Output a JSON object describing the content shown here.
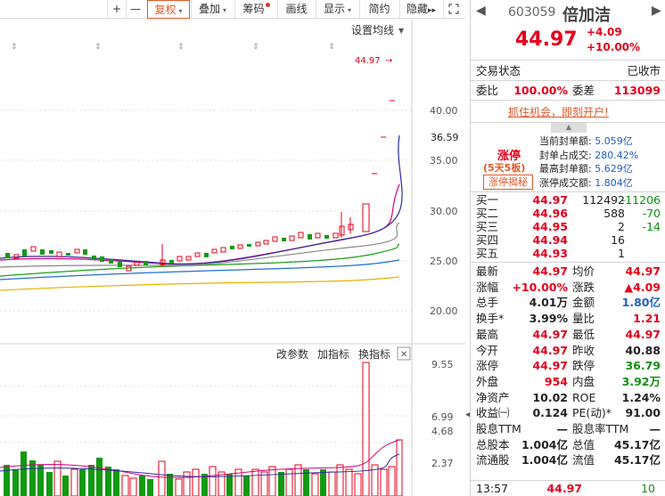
{
  "toolbar": {
    "plus": "+",
    "minus": "—",
    "fq": "复权",
    "overlay": "叠加",
    "chips": "筹码",
    "draw": "画线",
    "display": "显示",
    "brief": "简约",
    "hide": "隐藏",
    "hide_arrow": "▸▸"
  },
  "chart": {
    "ma_settings": "设置均线",
    "limit_price": "44.97",
    "current_price_tag": "36.59",
    "price_axis": [
      "40.00",
      "35.00",
      "30.00",
      "25.00",
      "20.00"
    ],
    "vol_axis": [
      "9.55",
      "6.99",
      "4.68",
      "2.37"
    ],
    "indicator_params": "改参数",
    "add_indicator": "加指标",
    "switch_indicator": "换指标",
    "close_x": "✕",
    "colors": {
      "up": "#e5001b",
      "down": "#119a11",
      "ma5": "#2b2b9f",
      "ma10": "#d9007a",
      "ma20": "#888888",
      "ma30": "#1aa01a",
      "ma60": "#1f6fd6",
      "ma120": "#e8b000"
    }
  },
  "panel": {
    "code": "603059",
    "name": "倍加洁",
    "price": "44.97",
    "change": "+4.09",
    "change_pct": "+10.00%",
    "status_label": "交易状态",
    "status_value": "已收市",
    "weibi_label": "委比",
    "weibi_value": "100.00%",
    "weicha_label": "委差",
    "weicha_value": "113099",
    "promo": "抓住机会，即刻开户!",
    "limit_title": "涨停",
    "limit_streak": "(5天5板)",
    "limit_reveal": "涨停揭秘",
    "seal_stats": [
      {
        "label": "当前封单额:",
        "value": "5.059亿"
      },
      {
        "label": "封单占成交:",
        "value": "280.42%"
      },
      {
        "label": "最高封单额:",
        "value": "5.629亿"
      },
      {
        "label": "涨停成交额:",
        "value": "1.804亿"
      }
    ],
    "bids": [
      {
        "label": "买一",
        "price": "44.97",
        "vol": "112492",
        "chg": "-11206"
      },
      {
        "label": "买二",
        "price": "44.96",
        "vol": "588",
        "chg": "-70"
      },
      {
        "label": "买三",
        "price": "44.95",
        "vol": "2",
        "chg": "-14"
      },
      {
        "label": "买四",
        "price": "44.94",
        "vol": "16",
        "chg": ""
      },
      {
        "label": "买五",
        "price": "44.93",
        "vol": "1",
        "chg": ""
      }
    ],
    "stats": [
      {
        "l1": "最新",
        "v1": "44.97",
        "c1": "red",
        "l2": "均价",
        "v2": "44.97",
        "c2": "red"
      },
      {
        "l1": "涨幅",
        "v1": "+10.00%",
        "c1": "red",
        "l2": "涨跌",
        "v2": "▲4.09",
        "c2": "red"
      },
      {
        "l1": "总手",
        "v1": "4.01万",
        "c1": "",
        "l2": "金额",
        "v2": "1.80亿",
        "c2": "blue"
      },
      {
        "l1": "换手*",
        "v1": "3.99%",
        "c1": "",
        "l2": "量比",
        "v2": "1.21",
        "c2": "red"
      },
      {
        "l1": "最高",
        "v1": "44.97",
        "c1": "red",
        "l2": "最低",
        "v2": "44.97",
        "c2": "red"
      },
      {
        "l1": "今开",
        "v1": "44.97",
        "c1": "red",
        "l2": "昨收",
        "v2": "40.88",
        "c2": ""
      },
      {
        "l1": "涨停",
        "v1": "44.97",
        "c1": "red",
        "l2": "跌停",
        "v2": "36.79",
        "c2": "green"
      },
      {
        "l1": "外盘",
        "v1": "954",
        "c1": "red",
        "l2": "内盘",
        "v2": "3.92万",
        "c2": "green"
      },
      {
        "l1": "净资产",
        "v1": "10.02",
        "c1": "",
        "l2": "ROE",
        "v2": "1.24%",
        "c2": ""
      },
      {
        "l1": "收益㈠",
        "v1": "0.124",
        "c1": "",
        "l2": "PE(动)*",
        "v2": "91.00",
        "c2": ""
      },
      {
        "l1": "股息TTM",
        "v1": "—",
        "c1": "",
        "l2": "股息率TTM",
        "v2": "—",
        "c2": ""
      },
      {
        "l1": "总股本",
        "v1": "1.004亿",
        "c1": "",
        "l2": "总值",
        "v2": "45.17亿",
        "c2": ""
      },
      {
        "l1": "流通股",
        "v1": "1.004亿",
        "c1": "",
        "l2": "流值",
        "v2": "45.17亿",
        "c2": ""
      }
    ],
    "tick": {
      "time": "13:57",
      "price": "44.97",
      "vol": "10"
    }
  }
}
